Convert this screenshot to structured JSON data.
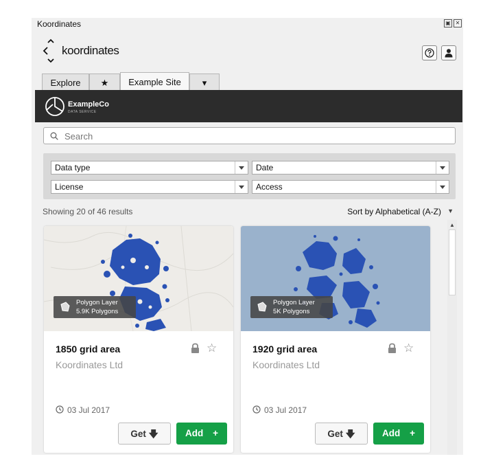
{
  "window": {
    "title": "Koordinates"
  },
  "app": {
    "brand": "koordinates"
  },
  "tabs": [
    {
      "label": "Explore"
    },
    {
      "label": "★"
    },
    {
      "label": "Example Site"
    },
    {
      "label": "▾"
    }
  ],
  "banner": {
    "name": "ExampleCo",
    "subtitle": "DATA SERVICE"
  },
  "search": {
    "placeholder": "Search",
    "value": ""
  },
  "filters": [
    {
      "label": "Data type"
    },
    {
      "label": "Date"
    },
    {
      "label": "License"
    },
    {
      "label": "Access"
    }
  ],
  "results": {
    "showing": "Showing 20 of 46 results",
    "sort": "Sort by Alphabetical (A-Z)"
  },
  "cards": [
    {
      "title": "1850 grid area",
      "publisher": "Koordinates Ltd",
      "layer_type": "Polygon Layer",
      "count": "5.9K Polygons",
      "date": "03 Jul 2017",
      "get_label": "Get",
      "add_label": "Add",
      "thumb_bg": "#eeece8"
    },
    {
      "title": "1920 grid area",
      "publisher": "Koordinates Ltd",
      "layer_type": "Polygon Layer",
      "count": "5K Polygons",
      "date": "03 Jul 2017",
      "get_label": "Get",
      "add_label": "Add",
      "thumb_bg": "#9ab2cc"
    }
  ],
  "colors": {
    "accent": "#15a047",
    "polygon": "#2a52b4",
    "banner": "#2c2c2c"
  }
}
